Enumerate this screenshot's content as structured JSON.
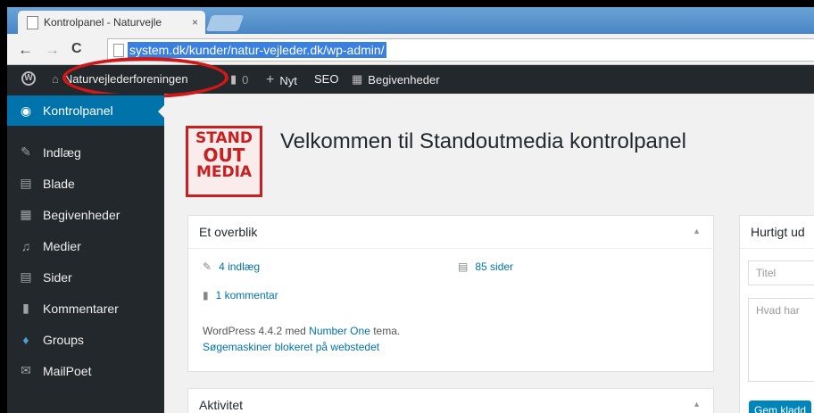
{
  "browser": {
    "tab_title": "Kontrolpanel - Naturvejle",
    "tab_close": "×",
    "back": "←",
    "forward": "→",
    "reload": "C",
    "url": "system.dk/kunder/natur-vejleder.dk/wp-admin/"
  },
  "adminbar": {
    "site_name": "Naturvejlederforeningen",
    "comments_count": "0",
    "new_label": "Nyt",
    "seo_label": "SEO",
    "events_label": "Begivenheder"
  },
  "sidebar": {
    "items": [
      {
        "label": "Kontrolpanel",
        "icon": "dashboard-icon"
      },
      {
        "label": "Indlæg",
        "icon": "pin-icon"
      },
      {
        "label": "Blade",
        "icon": "pages-icon"
      },
      {
        "label": "Begivenheder",
        "icon": "calendar-icon"
      },
      {
        "label": "Medier",
        "icon": "media-icon"
      },
      {
        "label": "Sider",
        "icon": "pages-icon"
      },
      {
        "label": "Kommentarer",
        "icon": "comment-icon"
      },
      {
        "label": "Groups",
        "icon": "groups-icon"
      },
      {
        "label": "MailPoet",
        "icon": "mail-icon"
      }
    ]
  },
  "main": {
    "logo_lines": [
      "STAND",
      "OUT",
      "MEDIA"
    ],
    "title": "Velkommen til Standoutmedia kontrolpanel",
    "overview": {
      "heading": "Et overblik",
      "posts": "4 indlæg",
      "pages": "85 sider",
      "comments": "1 kommentar",
      "version_prefix": "WordPress 4.4.2 med ",
      "theme_link": "Number One",
      "version_suffix": " tema.",
      "search_blocked": "Søgemaskiner blokeret på webstedet"
    },
    "activity": {
      "heading": "Aktivitet"
    },
    "quickdraft": {
      "heading": "Hurtigt ud",
      "title_placeholder": "Titel",
      "content_placeholder": "Hvad har",
      "save_button": "Gem kladd"
    }
  }
}
